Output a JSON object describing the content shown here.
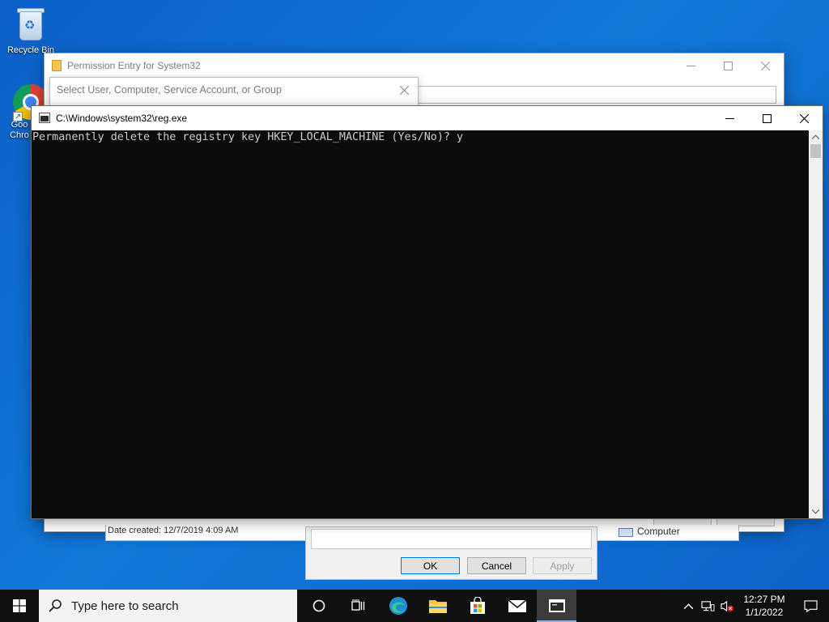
{
  "desktop": {
    "recycle_bin_label": "Recycle Bin",
    "chrome_label": "Google Chrome",
    "chrome_label_line1": "Goo",
    "chrome_label_line2": "Chro"
  },
  "permission_window": {
    "title": "Permission Entry for System32",
    "bottom_text": "Date created: 12/7/2019 4:09 AM"
  },
  "select_user_window": {
    "title": "Select User, Computer, Service Account, or Group",
    "buttons": {
      "ok": "OK",
      "cancel": "Cancel",
      "apply": "Apply"
    },
    "object_type": "Computer"
  },
  "console_window": {
    "title": "C:\\Windows\\system32\\reg.exe",
    "output": "Permanently delete the registry key HKEY_LOCAL_MACHINE (Yes/No)? y"
  },
  "taskbar": {
    "search_placeholder": "Type here to search",
    "apps": [
      "cortana-circle",
      "task-view",
      "edge",
      "file-explorer",
      "store",
      "mail",
      "reg-console"
    ],
    "clock_time": "12:27 PM",
    "clock_date": "1/1/2022"
  }
}
